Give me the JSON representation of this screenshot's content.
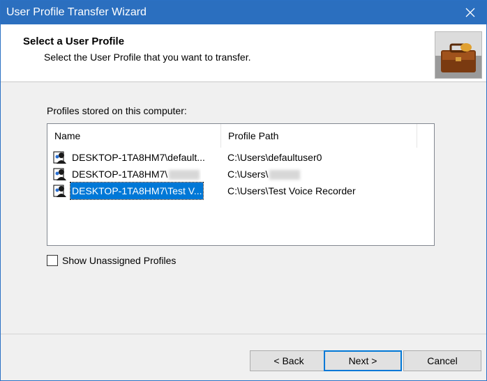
{
  "window": {
    "title": "User Profile Transfer Wizard"
  },
  "header": {
    "title": "Select a User Profile",
    "subtitle": "Select the User Profile that you want to transfer."
  },
  "profiles_label": "Profiles stored on this computer:",
  "list": {
    "columns": [
      "Name",
      "Profile Path"
    ],
    "rows": [
      {
        "name": "DESKTOP-1TA8HM7\\default...",
        "path": "C:\\Users\\defaultuser0",
        "selected": false
      },
      {
        "name": "DESKTOP-1TA8HM7\\",
        "path": "C:\\Users\\",
        "selected": false
      },
      {
        "name": "DESKTOP-1TA8HM7\\Test V...",
        "path": "C:\\Users\\Test Voice Recorder",
        "selected": true
      }
    ]
  },
  "checkbox": {
    "label": "Show Unassigned Profiles",
    "checked": false
  },
  "buttons": {
    "back": "< Back",
    "next": "Next >",
    "cancel": "Cancel"
  },
  "icons": {
    "close": "close-icon",
    "user_profile": "user-profile-icon",
    "header_image": "briefcase-image"
  },
  "colors": {
    "titlebar": "#2b6fbf",
    "selection": "#0078d7"
  }
}
